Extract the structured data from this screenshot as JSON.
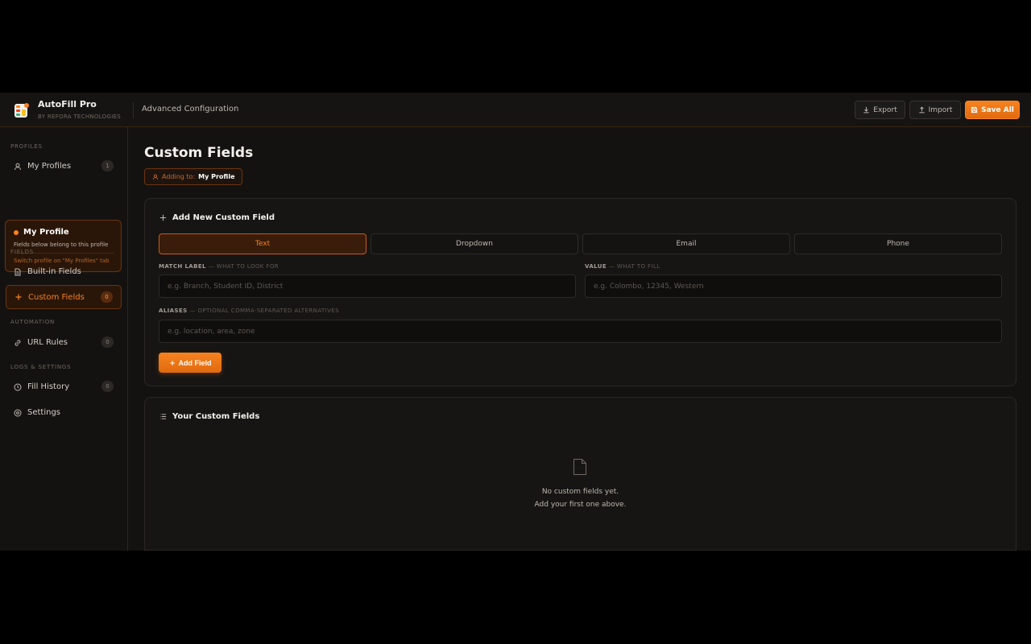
{
  "app": {
    "title": "AutoFill Pro",
    "subtitle": "BY REFORA TECHNOLOGIES",
    "context": "Advanced Configuration",
    "accent_color": "#f7821f"
  },
  "toolbar": {
    "export_label": "Export",
    "import_label": "Import",
    "save_label": "Save All"
  },
  "sidebar": {
    "profiles_section": "PROFILES",
    "my_profiles": {
      "label": "My Profiles",
      "count": "1"
    },
    "profile_card": {
      "name": "My Profile",
      "note": "Fields below belong to this profile",
      "switch_hint": "Switch profile on \"My Profiles\" tab"
    },
    "fields_section": "FIELDS",
    "builtin_fields": {
      "label": "Built-in Fields"
    },
    "custom_fields": {
      "label": "Custom Fields",
      "count": "0"
    },
    "automation_section": "AUTOMATION",
    "url_rules": {
      "label": "URL Rules",
      "count": "0"
    },
    "logs_section": "LOGS & SETTINGS",
    "fill_history": {
      "label": "Fill History",
      "count": "0"
    },
    "settings": {
      "label": "Settings"
    }
  },
  "main": {
    "title": "Custom Fields",
    "adding_to_label": "Adding to:",
    "adding_to_value": "My Profile",
    "new_field": {
      "heading": "Add New Custom Field",
      "types": [
        "Text",
        "Dropdown",
        "Email",
        "Phone"
      ],
      "selected_type": "Text",
      "match_label": {
        "label": "MATCH LABEL",
        "hint": "— WHAT TO LOOK FOR",
        "placeholder": "e.g. Branch, Student ID, District",
        "value": ""
      },
      "value_field": {
        "label": "VALUE",
        "hint": "— WHAT TO FILL",
        "placeholder": "e.g. Colombo, 12345, Western",
        "value": ""
      },
      "aliases": {
        "label": "ALIASES",
        "hint": "— OPTIONAL COMMA-SEPARATED ALTERNATIVES",
        "placeholder": "e.g. location, area, zone",
        "value": ""
      },
      "add_button": "Add Field"
    },
    "list": {
      "heading": "Your Custom Fields",
      "empty_line1": "No custom fields yet.",
      "empty_line2": "Add your first one above."
    }
  }
}
